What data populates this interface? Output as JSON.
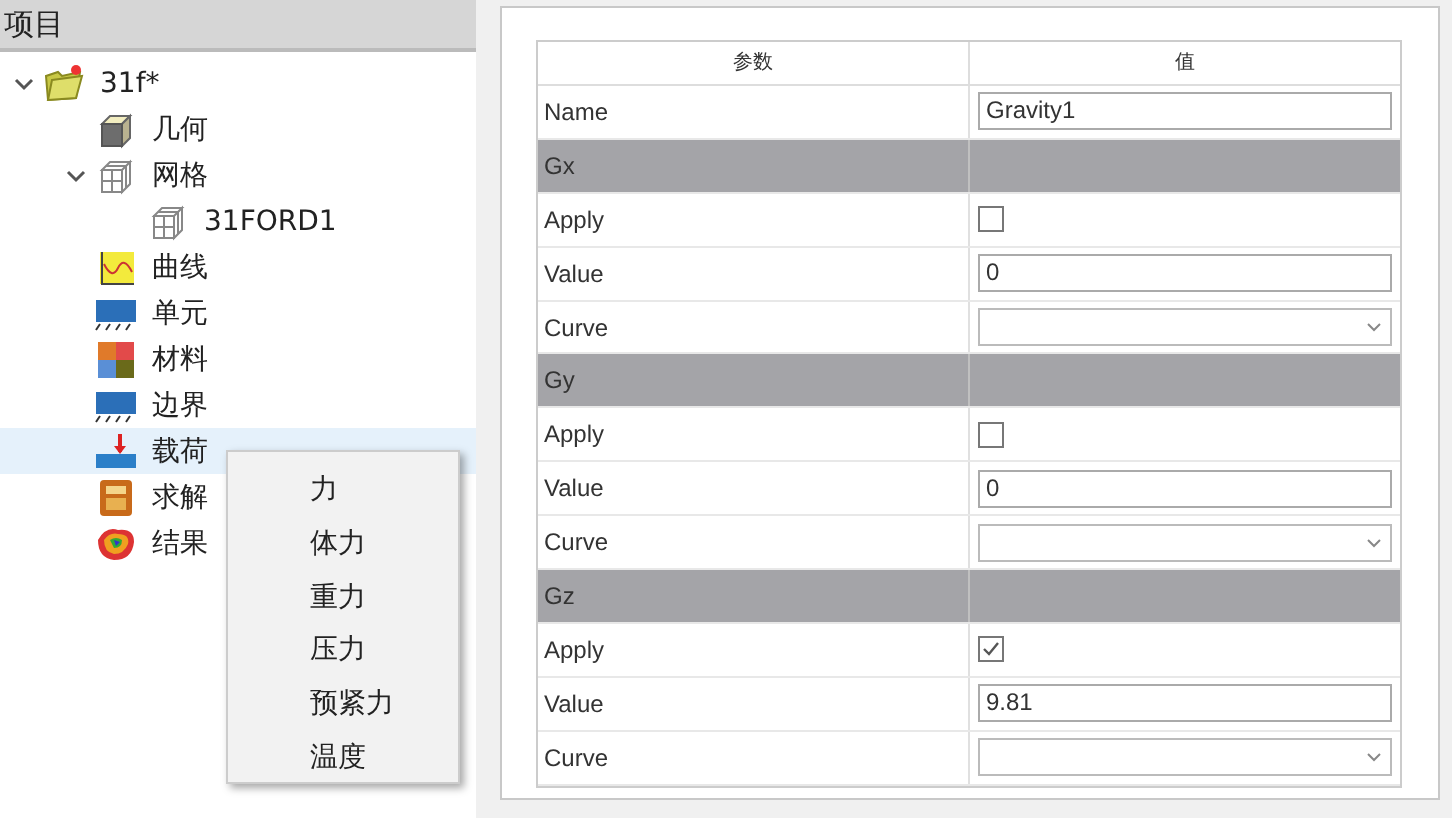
{
  "project_panel": {
    "title": "项目",
    "tree": [
      {
        "label": "31f*",
        "kind": "project",
        "expanded": true,
        "selected": false,
        "children": [
          {
            "label": "几何",
            "kind": "geometry",
            "selected": false
          },
          {
            "label": "网格",
            "kind": "mesh",
            "expanded": true,
            "selected": false,
            "children": [
              {
                "label": "31FORD1",
                "kind": "mesh",
                "selected": false
              }
            ]
          },
          {
            "label": "曲线",
            "kind": "curve",
            "selected": false
          },
          {
            "label": "单元",
            "kind": "element",
            "selected": false
          },
          {
            "label": "材料",
            "kind": "material",
            "selected": false
          },
          {
            "label": "边界",
            "kind": "boundary",
            "selected": false
          },
          {
            "label": "载荷",
            "kind": "load",
            "selected": true
          },
          {
            "label": "求解",
            "kind": "solver",
            "selected": false
          },
          {
            "label": "结果",
            "kind": "results",
            "selected": false
          }
        ]
      }
    ]
  },
  "context_menu": {
    "items": [
      "力",
      "体力",
      "重力",
      "压力",
      "预紧力",
      "温度"
    ]
  },
  "properties": {
    "columns": [
      "参数",
      "值"
    ],
    "rows": [
      {
        "kind": "text",
        "label": "Name",
        "value": "Gravity1"
      },
      {
        "kind": "group",
        "label": "Gx"
      },
      {
        "kind": "checkbox",
        "label": "Apply",
        "checked": false
      },
      {
        "kind": "text",
        "label": "Value",
        "value": "0"
      },
      {
        "kind": "dropdown",
        "label": "Curve"
      },
      {
        "kind": "group",
        "label": "Gy"
      },
      {
        "kind": "checkbox",
        "label": "Apply",
        "checked": false
      },
      {
        "kind": "text",
        "label": "Value",
        "value": "0"
      },
      {
        "kind": "dropdown",
        "label": "Curve"
      },
      {
        "kind": "group",
        "label": "Gz"
      },
      {
        "kind": "checkbox",
        "label": "Apply",
        "checked": true
      },
      {
        "kind": "text",
        "label": "Value",
        "value": "9.81"
      },
      {
        "kind": "dropdown",
        "label": "Curve"
      }
    ]
  }
}
